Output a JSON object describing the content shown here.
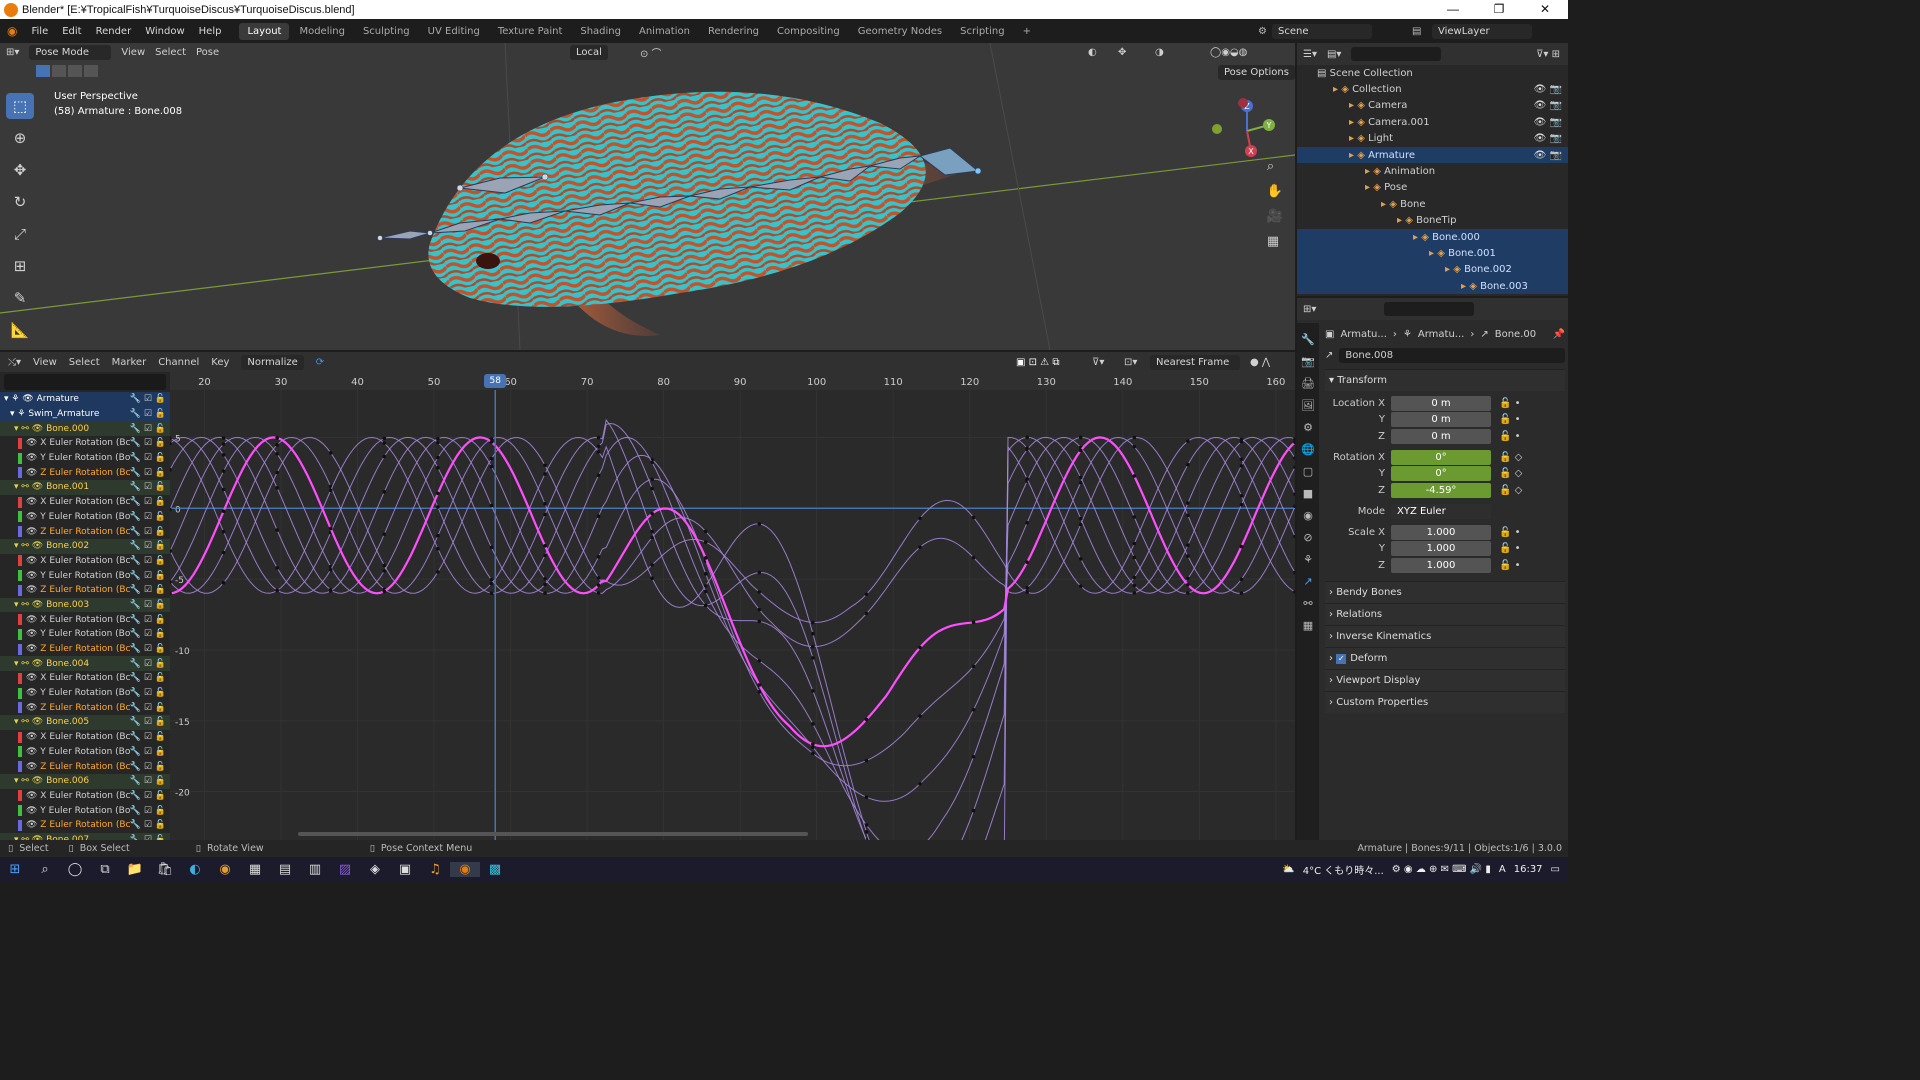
{
  "window": {
    "title": "Blender* [E:¥TropicalFish¥TurquoiseDiscus¥TurquoiseDiscus.blend]",
    "controls": [
      "—",
      "❐",
      "✕"
    ]
  },
  "menu": {
    "items": [
      "File",
      "Edit",
      "Render",
      "Window",
      "Help"
    ],
    "workspaces": [
      "Layout",
      "Modeling",
      "Sculpting",
      "UV Editing",
      "Texture Paint",
      "Shading",
      "Animation",
      "Rendering",
      "Compositing",
      "Geometry Nodes",
      "Scripting"
    ],
    "active_workspace": "Layout",
    "add_tab": "+",
    "scene": "Scene",
    "view_layer": "ViewLayer"
  },
  "viewport": {
    "mode": "Pose Mode",
    "menus": [
      "View",
      "Select",
      "Pose"
    ],
    "orientation": "Local",
    "info_line1": "User Perspective",
    "info_line2": "(58) Armature : Bone.008",
    "pose_options": "Pose Options",
    "gizmo_axes": [
      "X",
      "Y",
      "Z"
    ]
  },
  "graph_editor": {
    "menus": [
      "View",
      "Select",
      "Marker",
      "Channel",
      "Key"
    ],
    "normalize": "Normalize",
    "snap": "Nearest Frame",
    "current_frame": "58",
    "frame_ticks": [
      "20",
      "30",
      "40",
      "50",
      "60",
      "70",
      "80",
      "90",
      "100",
      "110",
      "120",
      "130",
      "140",
      "150",
      "160"
    ],
    "value_ticks": [
      "5",
      "0",
      "-5",
      "-10",
      "-15",
      "-20"
    ],
    "object": "Armature",
    "action": "Swim_Armature",
    "channels": [
      {
        "bone": "Bone.000",
        "curves": [
          "X Euler Rotation (Bc",
          "Y Euler Rotation (Bo",
          "Z Euler Rotation (Bc"
        ]
      },
      {
        "bone": "Bone.001",
        "curves": [
          "X Euler Rotation (Bc",
          "Y Euler Rotation (Bo",
          "Z Euler Rotation (Bc"
        ]
      },
      {
        "bone": "Bone.002",
        "curves": [
          "X Euler Rotation (Bc",
          "Y Euler Rotation (Bo",
          "Z Euler Rotation (Bc"
        ]
      },
      {
        "bone": "Bone.003",
        "curves": [
          "X Euler Rotation (Bc",
          "Y Euler Rotation (Bo",
          "Z Euler Rotation (Bc"
        ]
      },
      {
        "bone": "Bone.004",
        "curves": [
          "X Euler Rotation (Bc",
          "Y Euler Rotation (Bo",
          "Z Euler Rotation (Bc"
        ]
      },
      {
        "bone": "Bone.005",
        "curves": [
          "X Euler Rotation (Bc",
          "Y Euler Rotation (Bo",
          "Z Euler Rotation (Bc"
        ]
      },
      {
        "bone": "Bone.006",
        "curves": [
          "X Euler Rotation (Bc",
          "Y Euler Rotation (Bo",
          "Z Euler Rotation (Bc"
        ]
      }
    ],
    "partial_last": "Bone.007"
  },
  "outliner": {
    "root": "Scene Collection",
    "rows": [
      {
        "label": "Collection",
        "indent": 1,
        "sel": false
      },
      {
        "label": "Camera",
        "indent": 2,
        "sel": false
      },
      {
        "label": "Camera.001",
        "indent": 2,
        "sel": false
      },
      {
        "label": "Light",
        "indent": 2,
        "sel": false
      },
      {
        "label": "Armature",
        "indent": 2,
        "sel": true
      },
      {
        "label": "Animation",
        "indent": 3,
        "sel": false
      },
      {
        "label": "Pose",
        "indent": 3,
        "sel": false
      },
      {
        "label": "Bone",
        "indent": 4,
        "sel": false
      },
      {
        "label": "BoneTip",
        "indent": 5,
        "sel": false
      },
      {
        "label": "Bone.000",
        "indent": 6,
        "sel": true
      },
      {
        "label": "Bone.001",
        "indent": 7,
        "sel": true
      },
      {
        "label": "Bone.002",
        "indent": 8,
        "sel": true
      },
      {
        "label": "Bone.003",
        "indent": 9,
        "sel": true
      }
    ]
  },
  "properties": {
    "breadcrumb": [
      "Armatu...",
      "Armatu...",
      "Bone.00"
    ],
    "bone_name": "Bone.008",
    "transform_header": "Transform",
    "location": {
      "label": "Location X",
      "x": "0 m",
      "y": "0 m",
      "z": "0 m"
    },
    "rotation": {
      "label": "Rotation X",
      "x": "0°",
      "y": "0°",
      "z": "-4.59°"
    },
    "mode_label": "Mode",
    "mode": "XYZ Euler",
    "scale": {
      "label": "Scale X",
      "x": "1.000",
      "y": "1.000",
      "z": "1.000"
    },
    "axis_y": "Y",
    "axis_z": "Z",
    "panels": [
      "Bendy Bones",
      "Relations",
      "Inverse Kinematics",
      "Deform",
      "Viewport Display",
      "Custom Properties"
    ]
  },
  "statusbar": {
    "select": "Select",
    "box_select": "Box Select",
    "rotate_view": "Rotate View",
    "context_menu": "Pose Context Menu",
    "stats": "Armature | Bones:9/11 | Objects:1/6 | 3.0.0"
  },
  "taskbar": {
    "weather": "4°C くもり時々...",
    "time": "16:37",
    "ime": "A"
  },
  "colors": {
    "accent": "#4772b3",
    "active_curve": "#ff4fff",
    "curve": "#a88ae0",
    "fish_turquoise": "#3ac0c8",
    "fish_red": "#c0502a"
  }
}
